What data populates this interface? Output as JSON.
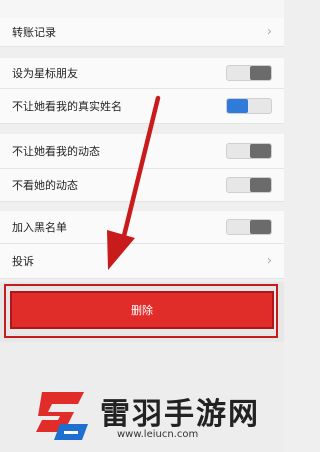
{
  "settings": {
    "transfer_records": "转账记录",
    "star_friend": "设为星标朋友",
    "hide_real_name": "不让她看我的真实姓名",
    "hide_my_moments": "不让她看我的动态",
    "hide_her_moments": "不看她的动态",
    "blacklist": "加入黑名单",
    "complaint": "投诉"
  },
  "toggles": {
    "star_friend": false,
    "hide_real_name": true,
    "hide_my_moments": false,
    "hide_her_moments": false,
    "blacklist": false
  },
  "delete_button": {
    "label": "删除"
  },
  "watermark": {
    "title": "雷羽手游网",
    "url": "www.leiucn.com"
  },
  "colors": {
    "delete_red": "#e02d2a",
    "toggle_on": "#2f7bd9",
    "annotation_red": "#c81b1b"
  }
}
